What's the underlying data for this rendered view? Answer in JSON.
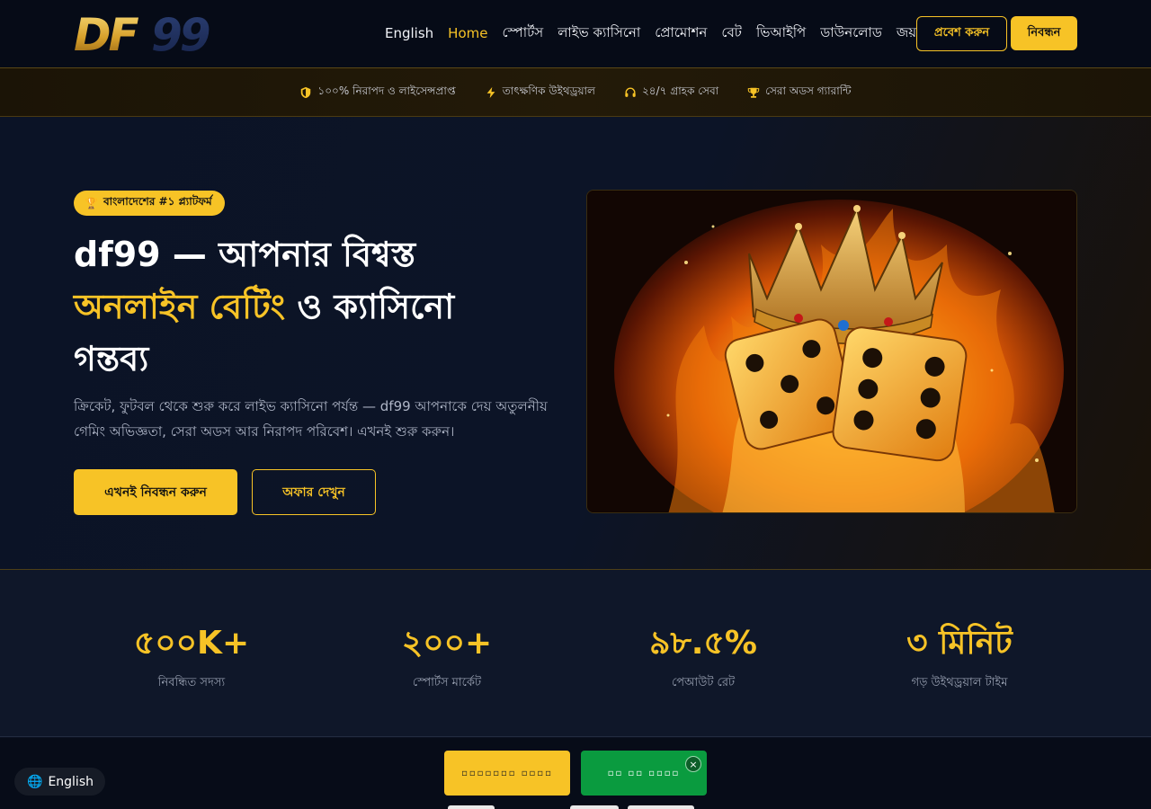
{
  "header": {
    "logo_text": "DF99",
    "nav": [
      {
        "label": "English",
        "active": false
      },
      {
        "label": "Home",
        "active": true
      },
      {
        "label": "স্পোর্টস",
        "active": false
      },
      {
        "label": "লাইভ ক্যাসিনো",
        "active": false
      },
      {
        "label": "প্রোমোশন",
        "active": false
      },
      {
        "label": "বেট",
        "active": false
      },
      {
        "label": "ভিআইপি",
        "active": false
      },
      {
        "label": "ডাউনলোড",
        "active": false
      },
      {
        "label": "জয়",
        "active": false
      }
    ],
    "login_label": "প্রবেশ করুন",
    "register_label": "নিবন্ধন"
  },
  "strip": {
    "items": [
      {
        "icon": "shield-icon",
        "label": "১০০% নিরাপদ ও লাইসেন্সপ্রাপ্ত"
      },
      {
        "icon": "lightning-icon",
        "label": "তাৎক্ষণিক উইথড্রয়াল"
      },
      {
        "icon": "headset-icon",
        "label": "২৪/৭ গ্রাহক সেবা"
      },
      {
        "icon": "trophy-icon",
        "label": "সেরা অডস গ্যারান্টি"
      }
    ]
  },
  "hero": {
    "badge": "বাংলাদেশের #১ প্ল্যাটফর্ম",
    "title_part1": "df99 — আপনার বিশ্বস্ত",
    "title_highlight": "অনলাইন বেটিং",
    "title_part2": " ও ক্যাসিনো",
    "title_part3": "গন্তব্য",
    "description": "ক্রিকেট, ফুটবল থেকে শুরু করে লাইভ ক্যাসিনো পর্যন্ত — df99 আপনাকে দেয় অতুলনীয় গেমিং অভিজ্ঞতা, সেরা অডস আর নিরাপদ পরিবেশ। এখনই শুরু করুন।",
    "cta_primary": "এখনই নিবন্ধন করুন",
    "cta_secondary": "অফার দেখুন"
  },
  "stats": [
    {
      "value": "৫০০K+",
      "label": "নিবন্ধিত সদস্য"
    },
    {
      "value": "২০০+",
      "label": "স্পোর্টস মার্কেট"
    },
    {
      "value": "৯৮.৫%",
      "label": "পেআউট রেট"
    },
    {
      "value": "৩ মিনিট",
      "label": "গড় উইথড্রয়াল টাইম"
    }
  ],
  "footer": {
    "lang_label": "English",
    "float_yellow_label": "▫▫▫▫▫▫▫ ▫▫▫▫",
    "float_green_label": "▫▫ ▫▫ ▫▫▫▫",
    "close_symbol": "×"
  },
  "colors": {
    "accent": "#f7c326",
    "background": "#0b1120",
    "green": "#0a9b3f"
  }
}
